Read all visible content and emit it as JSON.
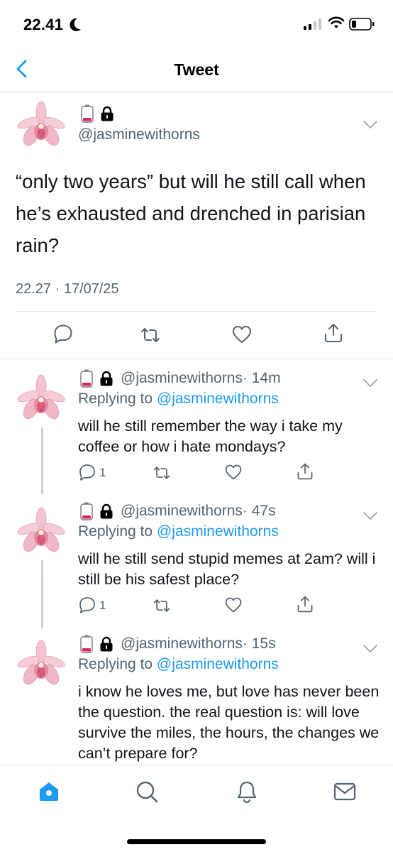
{
  "status_bar": {
    "time": "22.41"
  },
  "nav": {
    "title": "Tweet",
    "back_icon": "chevron-left-icon"
  },
  "main_tweet": {
    "handle": "@jasminewithorns",
    "text": "“only two years” but will he still call when he’s exhausted and drenched in parisian rain?",
    "timestamp": "22.27 · 17/07/25"
  },
  "replies": [
    {
      "handle": "@jasminewithorns",
      "time": "· 14m",
      "replying_prefix": "Replying to",
      "replying_to": "@jasminewithorns",
      "text": "will he still remember the way i take my coffee or how i hate mondays?",
      "reply_count": "1"
    },
    {
      "handle": "@jasminewithorns",
      "time": "· 47s",
      "replying_prefix": "Replying to",
      "replying_to": "@jasminewithorns",
      "text": "will he still send stupid memes at 2am? will i still be his safest place?",
      "reply_count": "1"
    },
    {
      "handle": "@jasminewithorns",
      "time": "· 15s",
      "replying_prefix": "Replying to",
      "replying_to": "@jasminewithorns",
      "text": "i know he loves me, but love has never been the question. the real question is: will love survive the miles, the hours, the changes we can’t prepare for?",
      "reply_count": ""
    }
  ],
  "tabs": [
    "home-icon",
    "search-icon",
    "notifications-bell-icon",
    "messages-mail-icon"
  ],
  "colors": {
    "accent": "#1d9bf0",
    "secondary_text": "#536471",
    "icon_gray": "#536471",
    "battery_red": "#e0245e"
  }
}
